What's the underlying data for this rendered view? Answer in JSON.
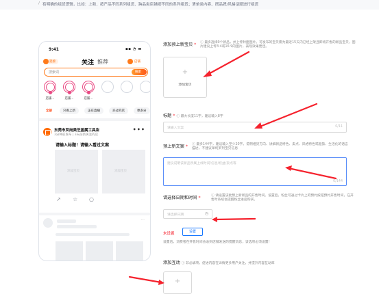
{
  "tip": {
    "mark": "/",
    "text": "有明确的组货逻辑，比如：上新、按产品不同系列组货、跨品类店铺按不同的系列组货；清单类内容、搭品牌/风格话题进行组货"
  },
  "phone": {
    "time": "9:41",
    "status_icons": "▪▪ ◔ ▬",
    "logo_label": "逛榜",
    "tabs": [
      "关注",
      "推荐"
    ],
    "shop_label": "店铺",
    "search_placeholder": "搜索词",
    "search_button": "搜索",
    "story_labels": [
      "店铺...",
      "店铺...",
      "店铺...",
      "",
      ""
    ],
    "chips": [
      "全部",
      "只看上新",
      "正在直播",
      "买过的店",
      "更多分"
    ],
    "post": {
      "shop_name": "东莞市凤岗美芝盖属工具店",
      "meta": "3分钟前发布 | 3天前新关注的店",
      "title": "请输入标题！请输入看过文案",
      "image_placeholder": "添加宝贝",
      "more": "•••"
    },
    "actions": [
      "↗",
      "☆",
      "○"
    ],
    "skeleton_more": "···"
  },
  "form": {
    "preview_items": {
      "label": "添加预上新宝贝",
      "required": "*",
      "hint": "ⓘ 最多选择9个新品，并上传封面图片。可发布的宝贝需为最近15天内已经上架且即将开售的新品宝贝，图片建议上传3:4或16:9的图片，表现效果更佳。",
      "upload_plus": "+",
      "upload_label": "添加宝贝"
    },
    "title": {
      "label": "标题",
      "required": "*",
      "hint": "ⓘ 最大长度11字，建议输入8字",
      "placeholder": "请输入文案",
      "count": "0/11"
    },
    "copy": {
      "label": "预上新文案",
      "required": "*",
      "hint": "ⓘ 最多144字，建议输入至少20字。说明组货方向、讲解新品特色、卖点、风格特色或趋势、生活化的语言描述，不建议单纯罗列宝贝信息",
      "placeholder": "建议说明该新品所属上线时间/信息/权益/卖点等",
      "count": "0/144"
    },
    "launch_date": {
      "label": "请选择日期和时间",
      "required": "*",
      "hint": "ⓘ 请设置该批预上新新品的开售时间。设置后，粉丝可通过卡片上的预约按钮预约开售时间，在开售时系统会提醒粉丝进店购买。",
      "placeholder": "请选择日期",
      "clock_icon": "◷"
    },
    "reminder": {
      "status": "未设置",
      "button": "设置",
      "desc": "设置后，消费者在开售时间会收到店铺发送的提醒消息，该选项必须设置!"
    },
    "interaction": {
      "label": "添加互动",
      "hint": "ⓘ 非必填项，促进内容在详情更多用户关注，并提升内容互动率",
      "upload_plus": "+"
    }
  },
  "colors": {
    "accent_orange": "#ff7a1a",
    "story_pink": "#e94b84",
    "required_red": "#f5222d",
    "link_blue": "#1677ff",
    "annotation_arrow": "#f5222d"
  }
}
